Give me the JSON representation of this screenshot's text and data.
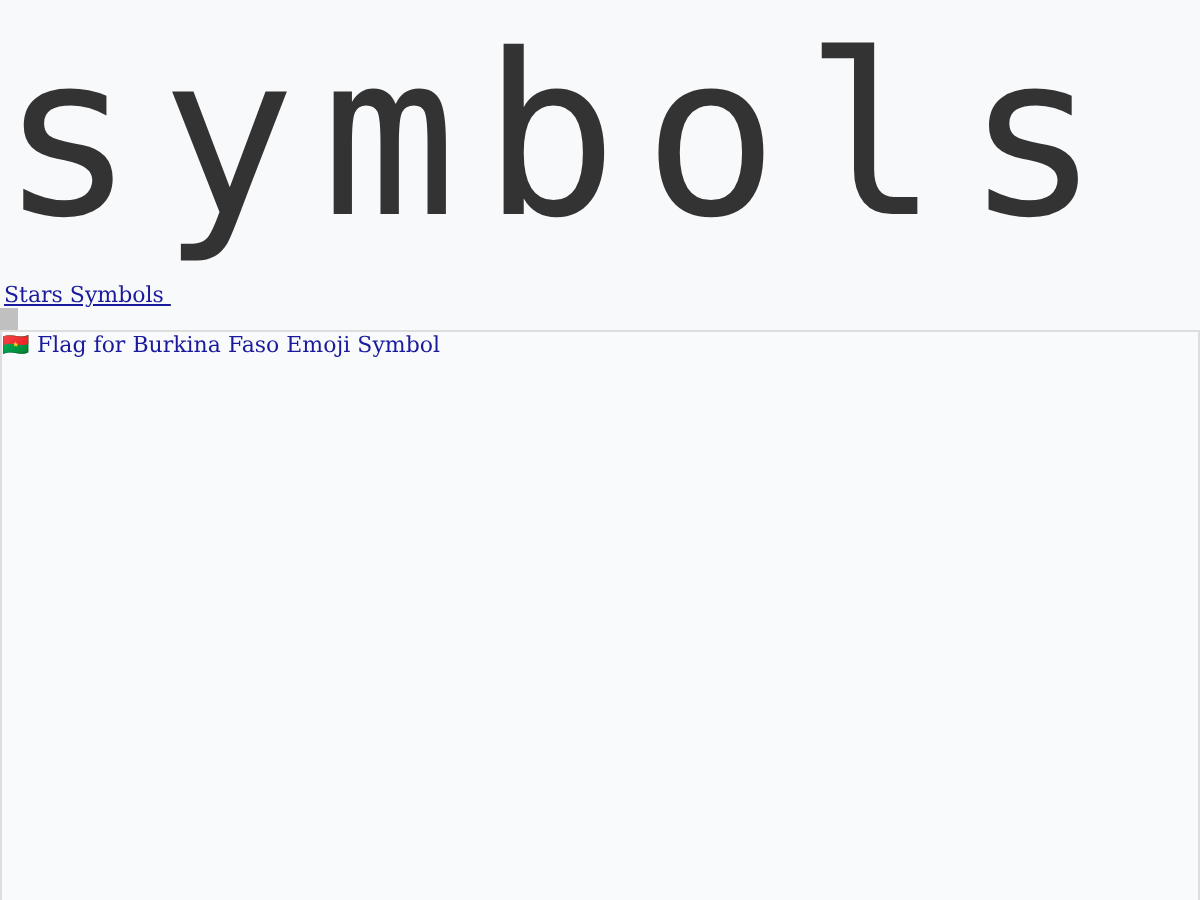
{
  "logo": {
    "text": "symbols"
  },
  "breadcrumb": {
    "link": "Stars Symbols "
  },
  "results": [
    {
      "label": "🇧🇫 Flag for Burkina Faso Emoji Symbol"
    }
  ]
}
